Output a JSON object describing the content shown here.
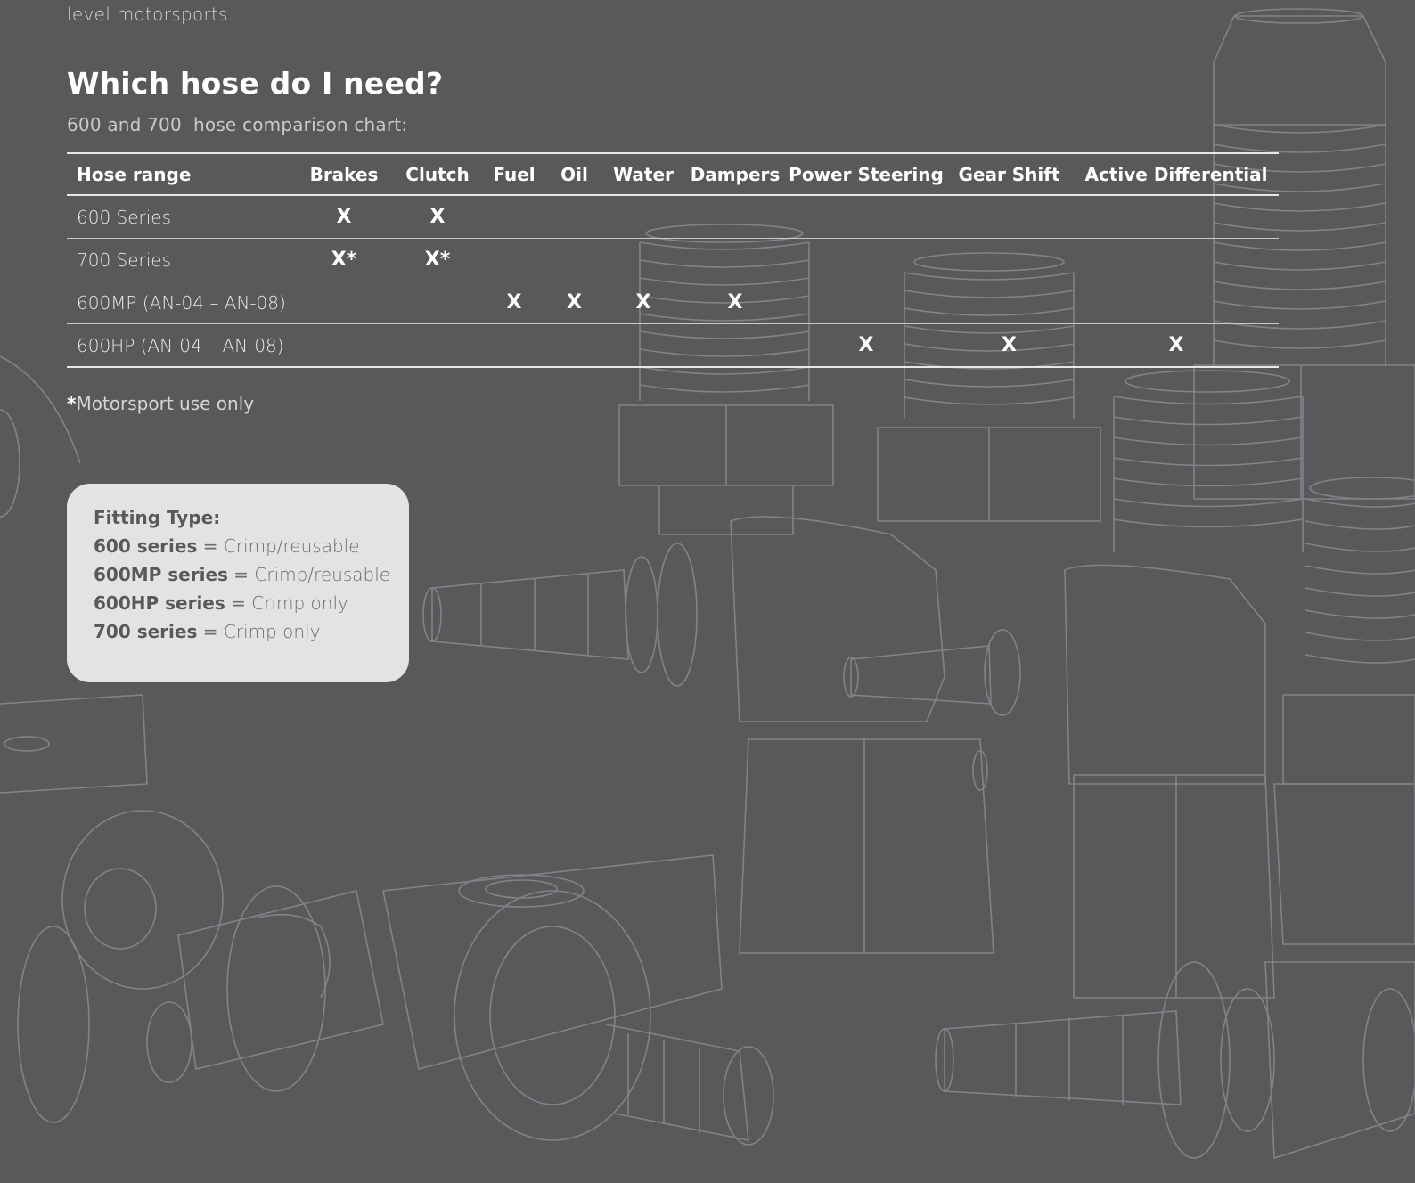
{
  "intro": {
    "tail_text": "level motorsports."
  },
  "heading": "Which hose do I need?",
  "subheading": "600 and 700  hose comparison chart:",
  "table": {
    "headers": [
      "Hose range",
      "Brakes",
      "Clutch",
      "Fuel",
      "Oil",
      "Water",
      "Dampers",
      "Power Steering",
      "Gear Shift",
      "Active Differential"
    ],
    "rows": [
      {
        "name": "600 Series",
        "cells": [
          "X",
          "X",
          "",
          "",
          "",
          "",
          "",
          "",
          ""
        ]
      },
      {
        "name": "700 Series",
        "cells": [
          "X*",
          "X*",
          "",
          "",
          "",
          "",
          "",
          "",
          ""
        ]
      },
      {
        "name": "600MP (AN-04 – AN-08)",
        "cells": [
          "",
          "",
          "X",
          "X",
          "X",
          "X",
          "",
          "",
          ""
        ]
      },
      {
        "name": "600HP (AN-04 – AN-08)",
        "cells": [
          "",
          "",
          "",
          "",
          "",
          "",
          "X",
          "X",
          "X"
        ]
      }
    ]
  },
  "footnote": {
    "star": "*",
    "text": "Motorsport use only"
  },
  "fitting_box": {
    "title": "Fitting Type:",
    "equals": "=",
    "items": [
      {
        "series": "600 series",
        "type": "Crimp/reusable"
      },
      {
        "series": "600MP series",
        "type": "Crimp/reusable"
      },
      {
        "series": "600HP series",
        "type": "Crimp only"
      },
      {
        "series": "700 series",
        "type": "Crimp only"
      }
    ]
  },
  "colors": {
    "background": "#58595b",
    "line_art": "#8c8d90",
    "box": "#e2e3e4",
    "text": "#ffffff"
  },
  "background_art": {
    "icon": "hose-fittings-line-illustration"
  }
}
